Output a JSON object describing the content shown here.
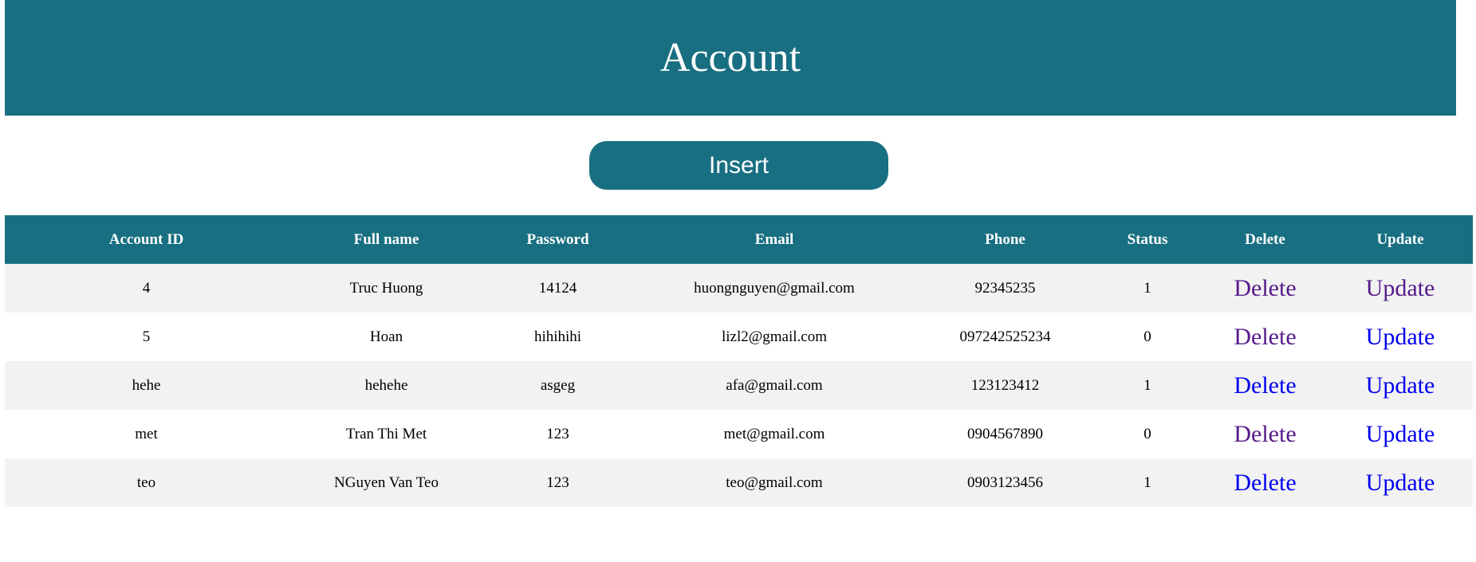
{
  "page": {
    "title": "Account",
    "insert_label": "Insert"
  },
  "colors": {
    "primary": "#186f81",
    "row_alt": "#f2f2f2",
    "link": "#0000ee",
    "link_visited": "#551a8b"
  },
  "table": {
    "headers": [
      "Account ID",
      "Full name",
      "Password",
      "Email",
      "Phone",
      "Status",
      "Delete",
      "Update"
    ],
    "rows": [
      {
        "id": "4",
        "fullname": "Truc Huong",
        "password": "14124",
        "email": "huongnguyen@gmail.com",
        "phone": "92345235",
        "status": "1",
        "delete_label": "Delete",
        "update_label": "Update",
        "delete_visited": true,
        "update_visited": true
      },
      {
        "id": "5",
        "fullname": "Hoan",
        "password": "hihihihi",
        "email": "lizl2@gmail.com",
        "phone": "097242525234",
        "status": "0",
        "delete_label": "Delete",
        "update_label": "Update",
        "delete_visited": true,
        "update_visited": false
      },
      {
        "id": "hehe",
        "fullname": "hehehe",
        "password": "asgeg",
        "email": "afa@gmail.com",
        "phone": "123123412",
        "status": "1",
        "delete_label": "Delete",
        "update_label": "Update",
        "delete_visited": false,
        "update_visited": false
      },
      {
        "id": "met",
        "fullname": "Tran Thi Met",
        "password": "123",
        "email": "met@gmail.com",
        "phone": "0904567890",
        "status": "0",
        "delete_label": "Delete",
        "update_label": "Update",
        "delete_visited": true,
        "update_visited": false
      },
      {
        "id": "teo",
        "fullname": "NGuyen Van Teo",
        "password": "123",
        "email": "teo@gmail.com",
        "phone": "0903123456",
        "status": "1",
        "delete_label": "Delete",
        "update_label": "Update",
        "delete_visited": false,
        "update_visited": false
      }
    ]
  }
}
